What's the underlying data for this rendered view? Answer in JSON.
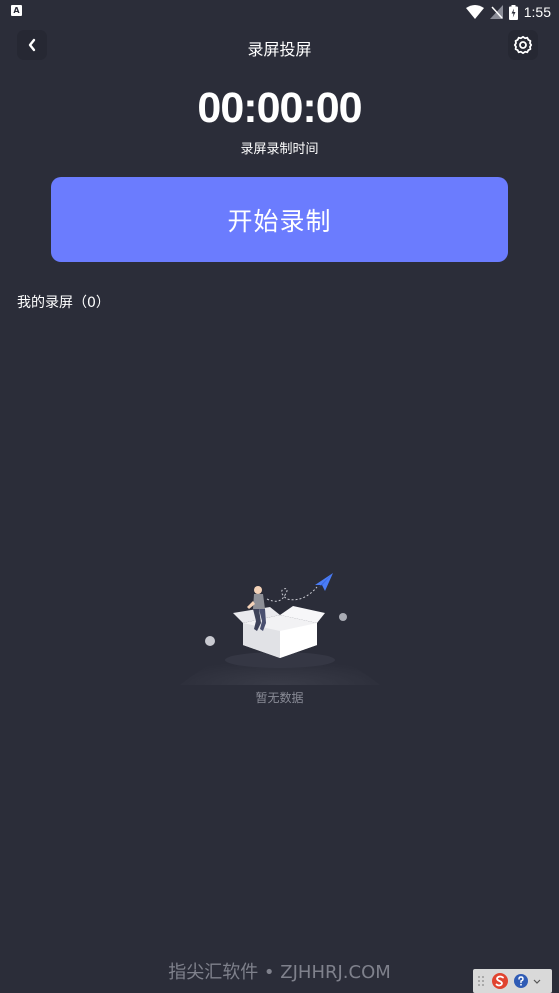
{
  "status_bar": {
    "left_icon_letter": "A",
    "time": "1:55",
    "icons": [
      "wifi-icon",
      "no-signal-icon",
      "battery-charging-icon"
    ]
  },
  "header": {
    "title": "录屏投屏",
    "back_icon": "chevron-left-icon",
    "settings_icon": "gear-icon"
  },
  "recorder": {
    "timer": "00:00:00",
    "timer_label": "录屏录制时间",
    "start_button_label": "开始录制"
  },
  "recordings": {
    "section_title": "我的录屏（0）",
    "empty_text": "暂无数据"
  },
  "watermark": "指尖汇软件 • ZJHHRJ.COM",
  "colors": {
    "background": "#2b2d39",
    "accent": "#6b7cfe",
    "button_bg": "#262833",
    "muted_text": "#8a8c97"
  }
}
